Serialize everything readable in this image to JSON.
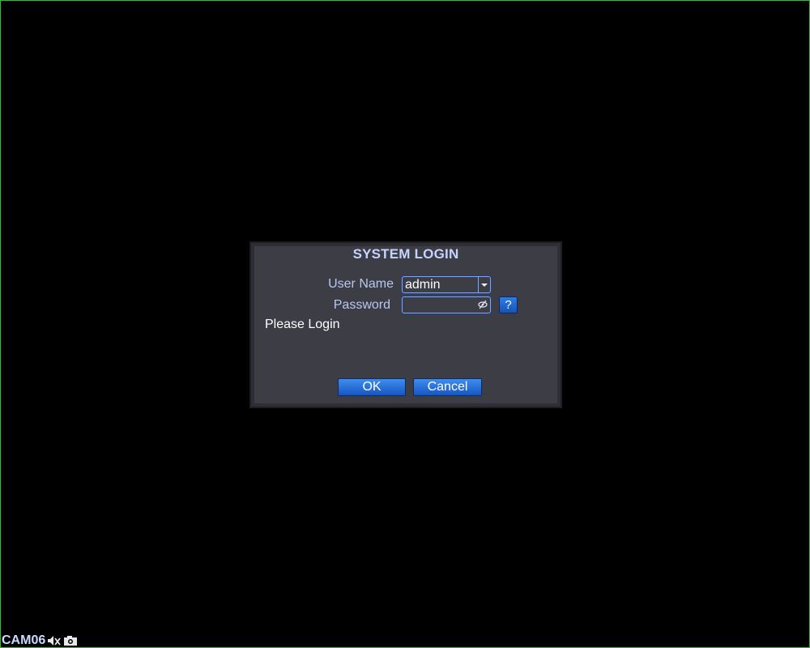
{
  "dialog": {
    "title": "SYSTEM LOGIN",
    "user_name_label": "User Name",
    "password_label": "Password",
    "user_name_value": "admin",
    "password_value": "",
    "help_label": "?",
    "status_message": "Please Login",
    "ok_label": "OK",
    "cancel_label": "Cancel"
  },
  "overlay": {
    "camera_label": "CAM06",
    "icons": [
      "mute-icon",
      "camera-icon"
    ]
  },
  "colors": {
    "screen_border": "#2fbf2f",
    "dialog_bg": "#3c3d45",
    "button_blue": "#1f6ad6",
    "label_text": "#b9c7f2"
  }
}
